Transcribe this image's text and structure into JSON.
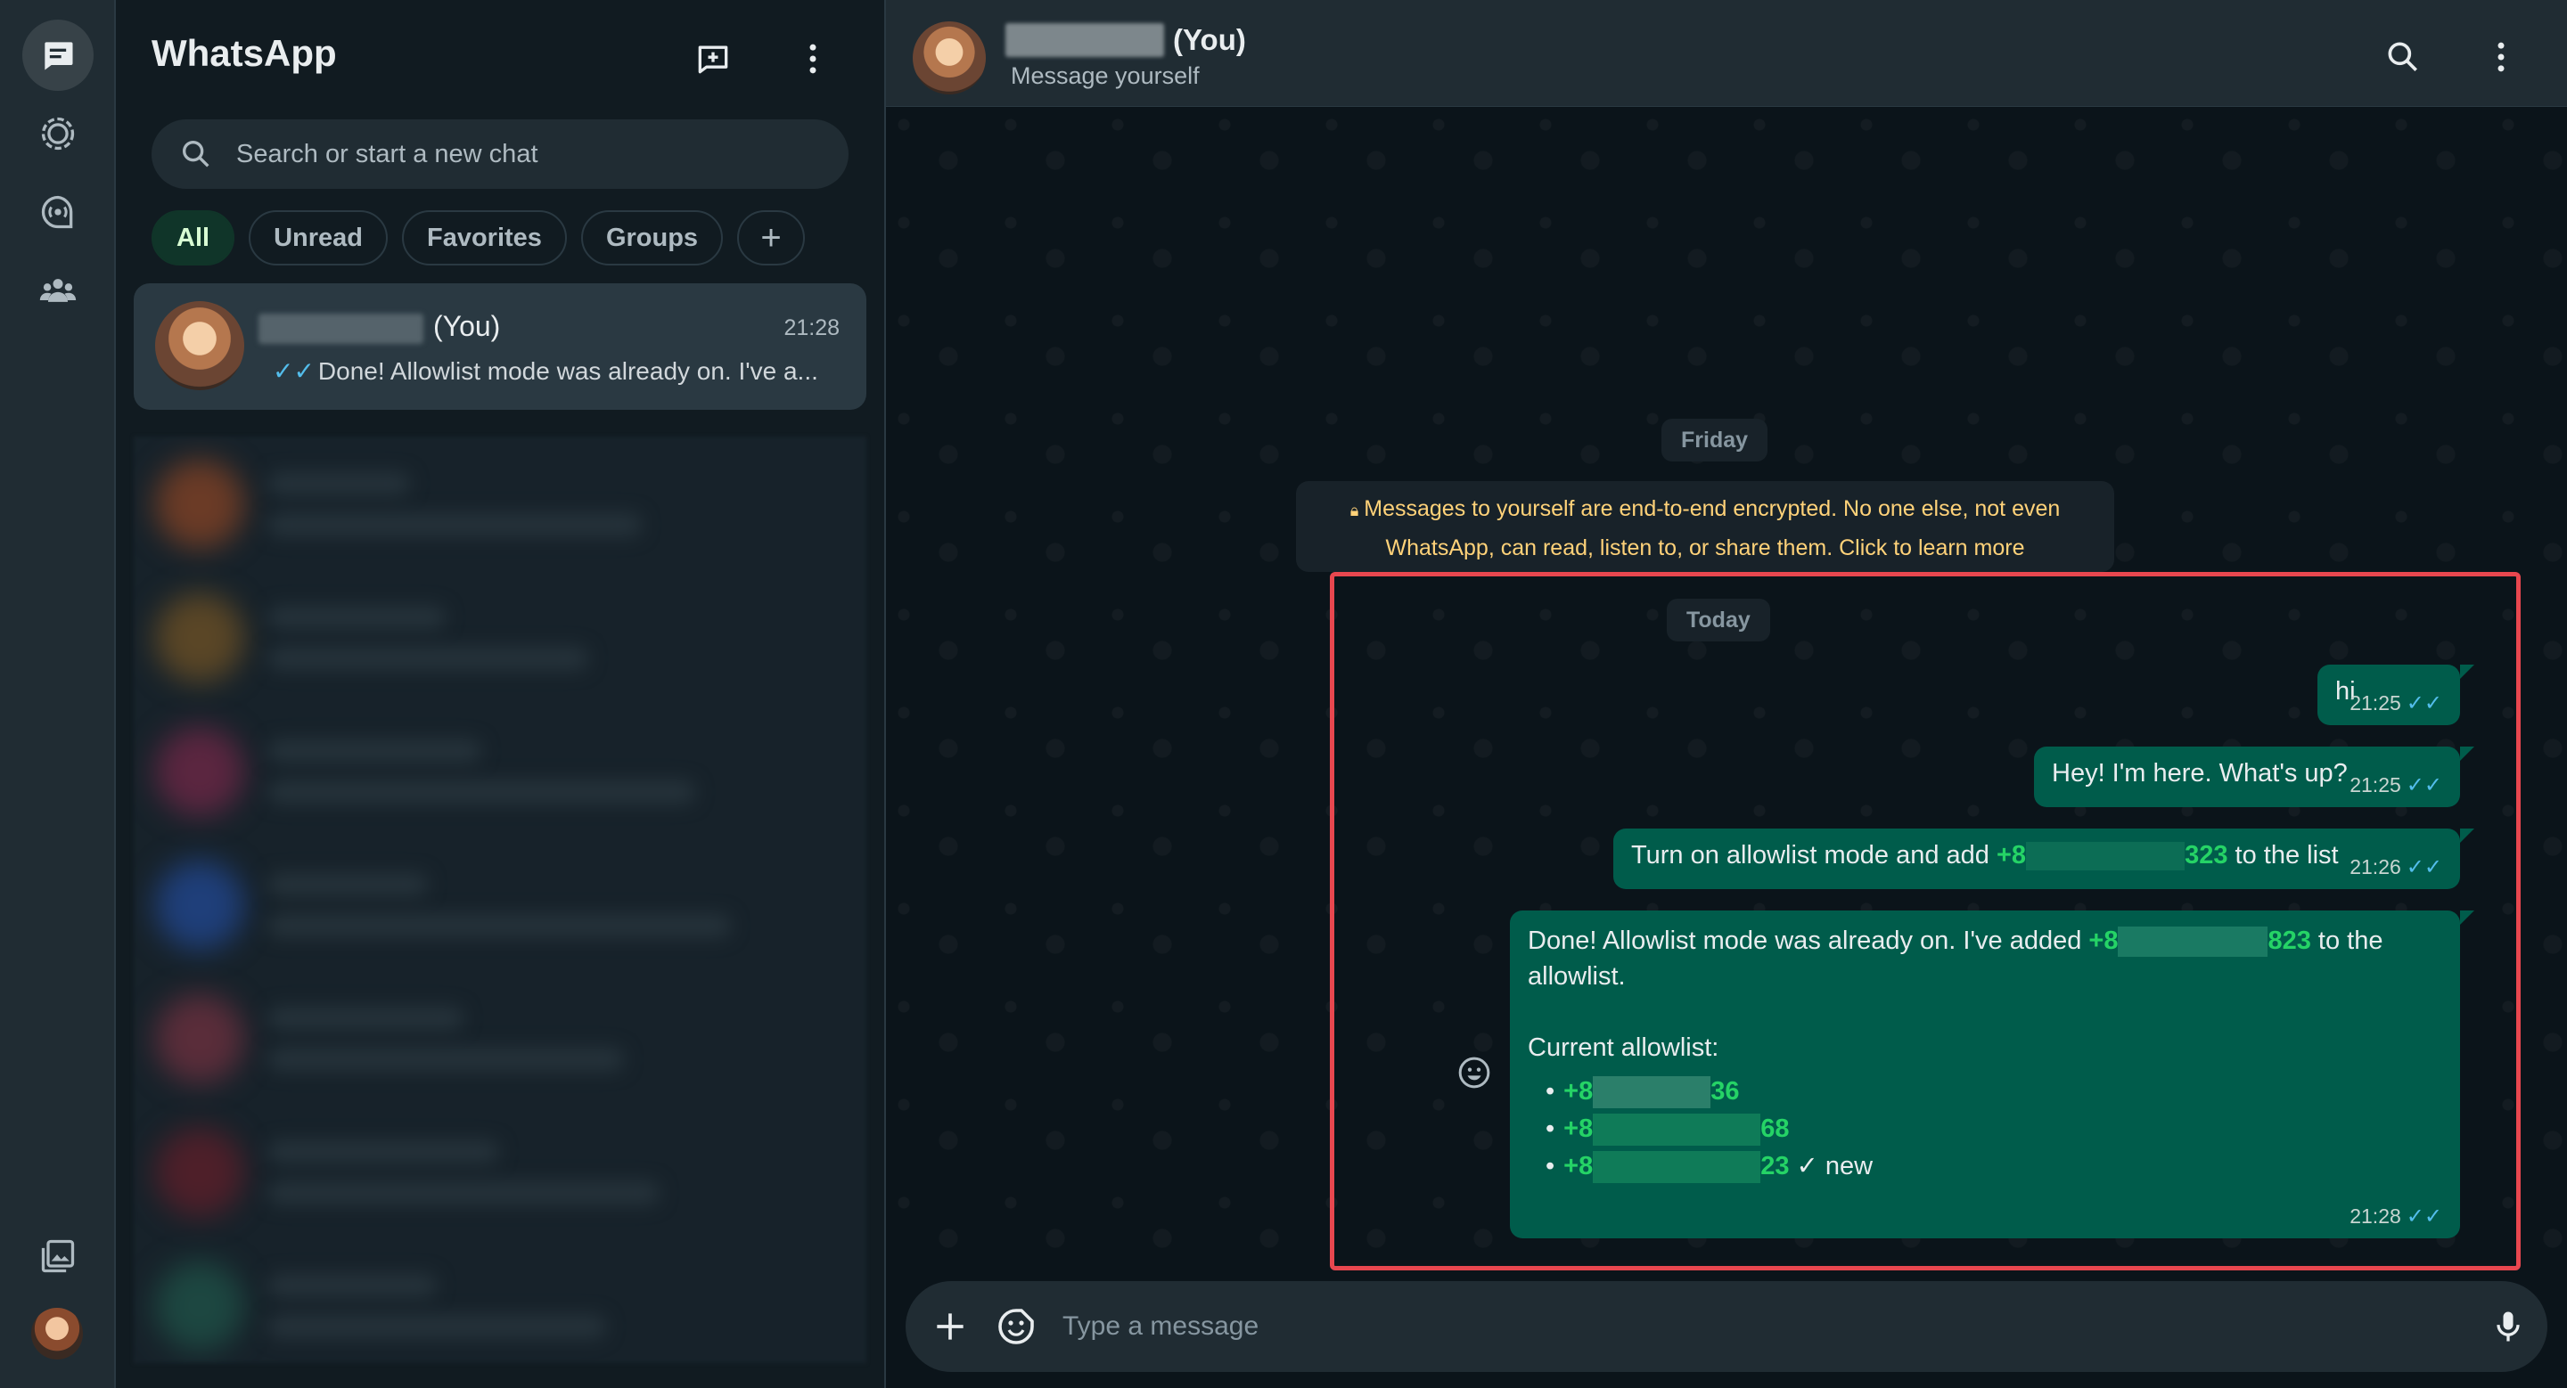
{
  "app": {
    "title": "WhatsApp"
  },
  "search": {
    "placeholder": "Search or start a new chat"
  },
  "filters": [
    {
      "label": "All",
      "active": true
    },
    {
      "label": "Unread"
    },
    {
      "label": "Favorites"
    },
    {
      "label": "Groups"
    }
  ],
  "chat_list": [
    {
      "name_suffix": "(You)",
      "time": "21:28",
      "preview_ticks": "✓✓",
      "preview": "Done! Allowlist mode was already on. I've a..."
    }
  ],
  "conversation": {
    "name_suffix": "(You)",
    "subtitle": "Message yourself",
    "date_friday": "Friday",
    "encryption_line1": "Messages to yourself are end-to-end encrypted. No one else, not even",
    "encryption_line2": "WhatsApp, can read, listen to, or share them. Click to learn more",
    "date_today": "Today",
    "messages": [
      {
        "text": "hi",
        "time": "21:25",
        "ticks": "✓✓"
      },
      {
        "text": "Hey! I'm here. What's up?",
        "time": "21:25",
        "ticks": "✓✓"
      },
      {
        "text_a": "Turn on allowlist mode and add ",
        "num_start": "+8",
        "num_end": "323",
        "text_b": " to the list",
        "time": "21:26",
        "ticks": "✓✓"
      },
      {
        "line1_a": "Done! Allowlist mode was already on. I've added ",
        "line1_num_start": "+8",
        "line1_num_end": "823",
        "line1_b": " to the",
        "line2": "allowlist.",
        "line3": "Current allowlist:",
        "allowlist": [
          {
            "bullet": "•",
            "start": "+8",
            "end": "36",
            "note": ""
          },
          {
            "bullet": "•",
            "start": "+8",
            "end": "68",
            "note": ""
          },
          {
            "bullet": "•",
            "start": "+8",
            "end": "23",
            "note": " ✓ new"
          }
        ],
        "time": "21:28",
        "ticks": "✓✓"
      }
    ]
  },
  "composer": {
    "placeholder": "Type a message"
  },
  "icons": {
    "rail": [
      "chats-icon",
      "status-icon",
      "channels-icon",
      "communities-icon",
      "media-icon"
    ],
    "list_header": [
      "new-chat-icon",
      "menu-icon"
    ],
    "conversation_header": [
      "search-icon",
      "menu-icon"
    ],
    "composer": [
      "attach-icon",
      "sticker-icon",
      "mic-icon"
    ]
  },
  "colors": {
    "accent": "#25d366",
    "outgoing_bubble": "#005c4b",
    "read_ticks": "#53bdeb",
    "highlight_box": "#e8474f",
    "encryption_text": "#ffd279"
  }
}
